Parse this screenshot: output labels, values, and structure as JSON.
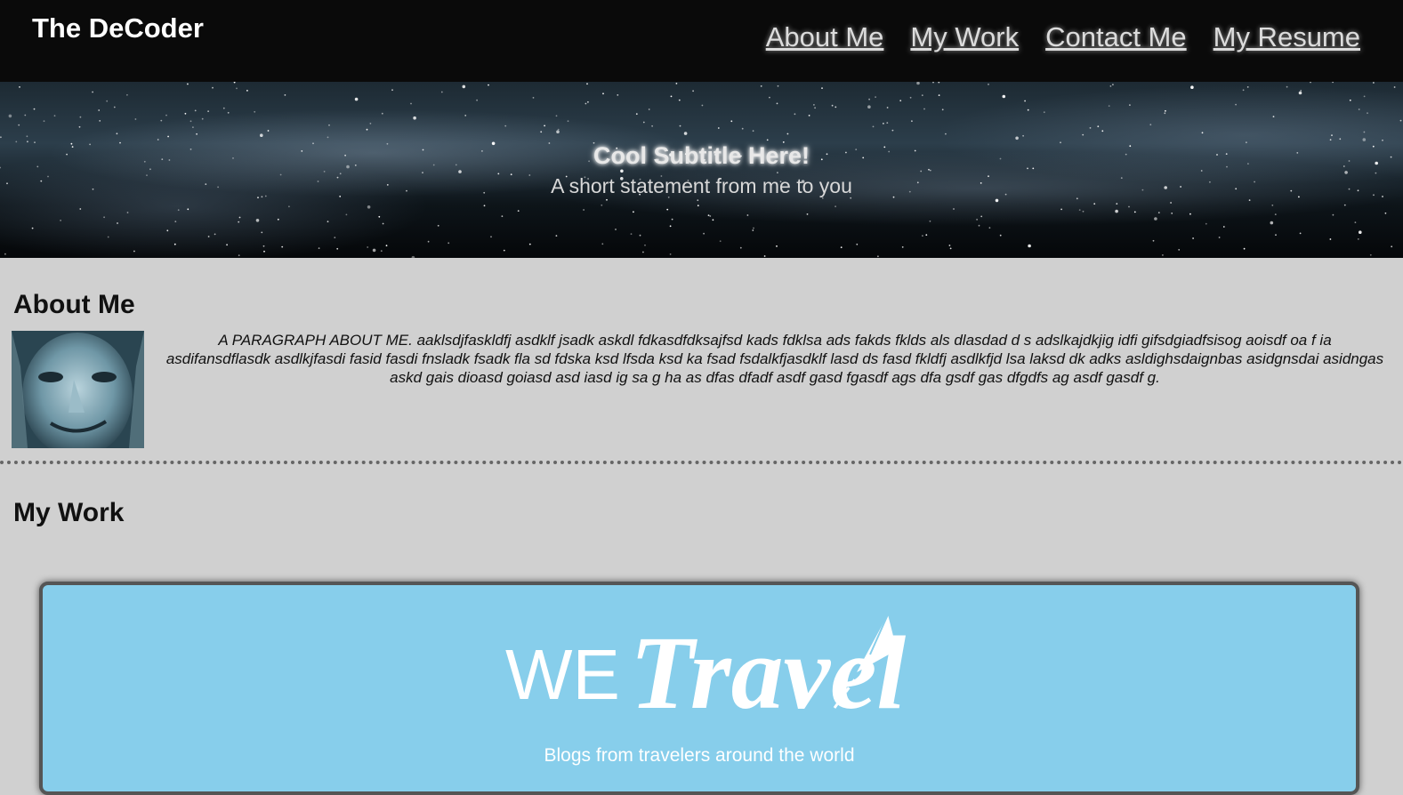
{
  "header": {
    "brand": "The DeCoder",
    "nav": [
      {
        "label": "About Me"
      },
      {
        "label": "My Work"
      },
      {
        "label": "Contact Me"
      },
      {
        "label": "My Resume"
      }
    ]
  },
  "hero": {
    "title": "Cool Subtitle Here!",
    "subtitle": "A short statement from me to you"
  },
  "about": {
    "heading": "About Me",
    "paragraph": "A PARAGRAPH ABOUT ME. aaklsdjfaskldfj asdklf jsadk askdl fdkasdfdksajfsd kads fdklsa ads fakds fklds als dlasdad d s adslkajdkjig idfi gifsdgiadfsisog aoisdf oa f ia asdifansdflasdk asdlkjfasdi fasid fasdi fnsladk fsadk fla sd fdska ksd lfsda ksd ka fsad fsdalkfjasdklf lasd ds fasd fkldfj asdlkfjd lsa laksd dk adks asldighsdaignbas asidgnsdai asidngas askd gais dioasd goiasd asd iasd ig sa g ha as dfas dfadf asdf gasd fgasdf ags dfa gsdf gas dfgdfs ag asdf gasdf g."
  },
  "work": {
    "heading": "My Work",
    "card": {
      "logo_text_we": "WE",
      "logo_text_travel": "Travel",
      "caption": "Blogs from travelers around the world",
      "background_color": "#87ceeb"
    }
  },
  "colors": {
    "header_bg": "#0a0a0a",
    "page_bg": "#d0d0d0",
    "card_bg": "#87ceeb"
  }
}
